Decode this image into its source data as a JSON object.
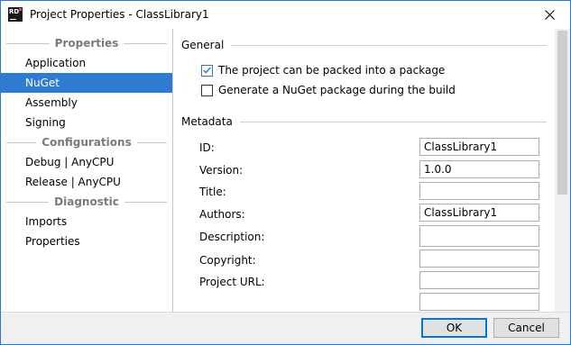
{
  "window": {
    "title": "Project Properties - ClassLibrary1",
    "app_icon_text": "RD",
    "close_icon": "close-icon"
  },
  "sidebar": {
    "groups": [
      {
        "label": "Properties",
        "items": [
          {
            "label": "Application"
          },
          {
            "label": "NuGet",
            "selected": true
          },
          {
            "label": "Assembly"
          },
          {
            "label": "Signing"
          }
        ]
      },
      {
        "label": "Configurations",
        "items": [
          {
            "label": "Debug | AnyCPU"
          },
          {
            "label": "Release | AnyCPU"
          }
        ]
      },
      {
        "label": "Diagnostic",
        "items": [
          {
            "label": "Imports"
          },
          {
            "label": "Properties"
          }
        ]
      }
    ]
  },
  "general": {
    "header": "General",
    "pack_checkbox": {
      "label": "The project can be packed into a package",
      "checked": true
    },
    "generate_checkbox": {
      "label": "Generate a NuGet package during the build",
      "checked": false
    }
  },
  "metadata": {
    "header": "Metadata",
    "fields": [
      {
        "label": "ID:",
        "value": "ClassLibrary1"
      },
      {
        "label": "Version:",
        "value": "1.0.0"
      },
      {
        "label": "Title:",
        "value": ""
      },
      {
        "label": "Authors:",
        "value": "ClassLibrary1"
      },
      {
        "label": "Description:",
        "value": ""
      },
      {
        "label": "Copyright:",
        "value": ""
      },
      {
        "label": "Project URL:",
        "value": ""
      }
    ]
  },
  "footer": {
    "ok_label": "OK",
    "cancel_label": "Cancel"
  },
  "colors": {
    "accent": "#2e7bd1",
    "window_border": "#2b79c7"
  }
}
